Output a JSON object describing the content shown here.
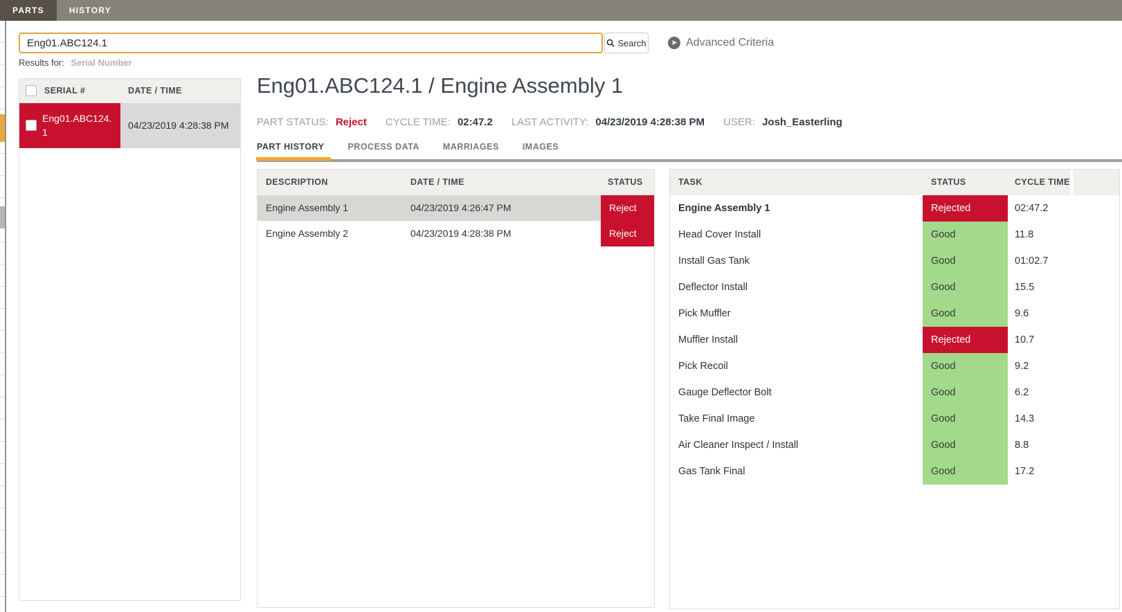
{
  "colors": {
    "red": "#c8112e",
    "green": "#a3d98b",
    "orange": "#f4a82a",
    "topbar": "#87827a",
    "topbar_active": "#57514a"
  },
  "topbar": {
    "tabs": [
      {
        "label": "PARTS",
        "active": true
      },
      {
        "label": "HISTORY",
        "active": false
      }
    ]
  },
  "search": {
    "value": "Eng01.ABC124.1",
    "button_label": "Search",
    "advanced_label": "Advanced Criteria",
    "results_for_label": "Results for:",
    "results_for_value": "Serial Number"
  },
  "results_table": {
    "columns": [
      "SERIAL #",
      "DATE / TIME"
    ],
    "rows": [
      {
        "serial": "Eng01.ABC124.1",
        "datetime": "04/23/2019 4:28:38 PM",
        "selected": true
      }
    ]
  },
  "detail": {
    "title": "Eng01.ABC124.1 / Engine Assembly 1",
    "summary": [
      {
        "label": "PART STATUS:",
        "value": "Reject",
        "value_type": "reject"
      },
      {
        "label": "CYCLE TIME:",
        "value": "02:47.2"
      },
      {
        "label": "LAST ACTIVITY:",
        "value": "04/23/2019 4:28:38 PM"
      },
      {
        "label": "USER:",
        "value": "Josh_Easterling"
      }
    ],
    "tabs": [
      {
        "label": "PART HISTORY",
        "active": true
      },
      {
        "label": "PROCESS DATA",
        "active": false
      },
      {
        "label": "MARRIAGES",
        "active": false
      },
      {
        "label": "IMAGES",
        "active": false
      }
    ]
  },
  "history_table": {
    "columns": [
      "DESCRIPTION",
      "DATE / TIME",
      "STATUS"
    ],
    "rows": [
      {
        "description": "Engine Assembly 1",
        "datetime": "04/23/2019 4:26:47 PM",
        "status": "Reject",
        "status_type": "reject",
        "selected": true
      },
      {
        "description": "Engine Assembly 2",
        "datetime": "04/23/2019 4:28:38 PM",
        "status": "Reject",
        "status_type": "reject"
      }
    ]
  },
  "task_table": {
    "columns": [
      "TASK",
      "STATUS",
      "CYCLE TIME"
    ],
    "rows": [
      {
        "task": "Engine Assembly 1",
        "status": "Rejected",
        "status_type": "reject",
        "cycle": "02:47.2",
        "bold": true
      },
      {
        "task": "Head Cover Install",
        "status": "Good",
        "status_type": "good",
        "cycle": "11.8"
      },
      {
        "task": "Install Gas Tank",
        "status": "Good",
        "status_type": "good",
        "cycle": "01:02.7"
      },
      {
        "task": "Deflector Install",
        "status": "Good",
        "status_type": "good",
        "cycle": "15.5"
      },
      {
        "task": "Pick Muffler",
        "status": "Good",
        "status_type": "good",
        "cycle": "9.6"
      },
      {
        "task": "Muffler Install",
        "status": "Rejected",
        "status_type": "reject",
        "cycle": "10.7"
      },
      {
        "task": "Pick Recoil",
        "status": "Good",
        "status_type": "good",
        "cycle": "9.2"
      },
      {
        "task": "Gauge Deflector Bolt",
        "status": "Good",
        "status_type": "good",
        "cycle": "6.2"
      },
      {
        "task": "Take Final Image",
        "status": "Good",
        "status_type": "good",
        "cycle": "14.3"
      },
      {
        "task": "Air Cleaner Inspect / Install",
        "status": "Good",
        "status_type": "good",
        "cycle": "8.8"
      },
      {
        "task": "Gas Tank Final",
        "status": "Good",
        "status_type": "good",
        "cycle": "17.2"
      }
    ]
  }
}
